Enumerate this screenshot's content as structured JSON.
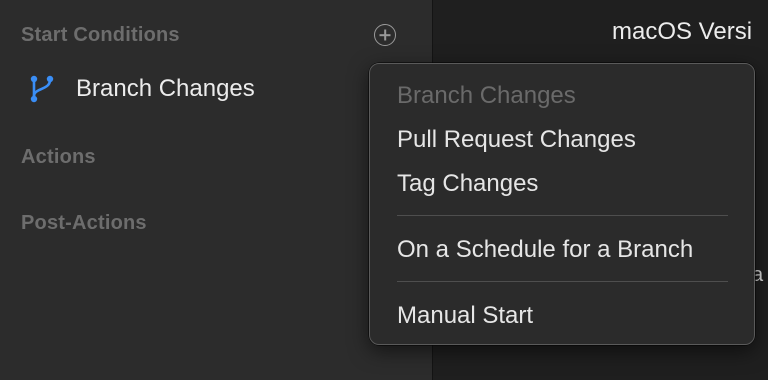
{
  "sidebar": {
    "sections": {
      "start_conditions": "Start Conditions",
      "actions": "Actions",
      "post_actions": "Post-Actions"
    },
    "add_button_icon": "plus-circle-icon",
    "condition": {
      "label": "Branch Changes",
      "icon": "branch-icon",
      "icon_color": "#3a8ef6"
    }
  },
  "right_pane": {
    "title": "macOS Versi",
    "peek_text": "a"
  },
  "menu": {
    "items": [
      {
        "label": "Branch Changes",
        "enabled": false
      },
      {
        "label": "Pull Request Changes",
        "enabled": true
      },
      {
        "label": "Tag Changes",
        "enabled": true
      },
      {
        "label": "On a Schedule for a Branch",
        "enabled": true
      },
      {
        "label": "Manual Start",
        "enabled": true
      }
    ]
  }
}
